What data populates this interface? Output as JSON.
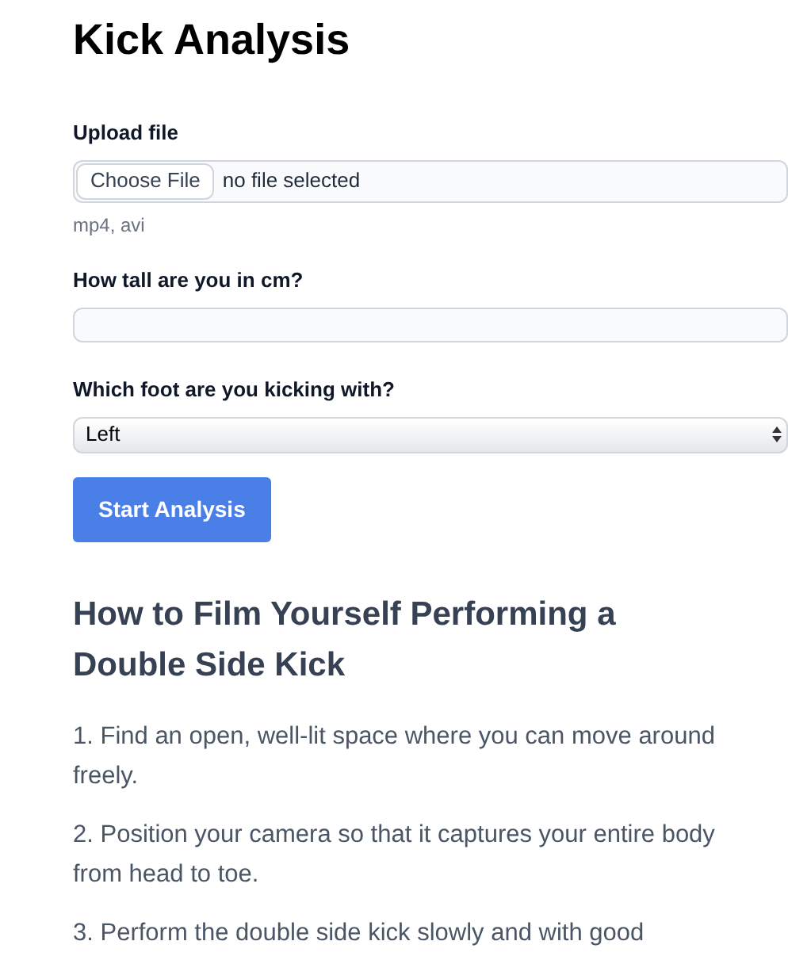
{
  "title": "Kick Analysis",
  "upload": {
    "label": "Upload file",
    "button": "Choose File",
    "status": "no file selected",
    "hint": "mp4, avi"
  },
  "height": {
    "label": "How tall are you in cm?"
  },
  "foot": {
    "label": "Which foot are you kicking with?",
    "value": "Left"
  },
  "submit": "Start Analysis",
  "guide": {
    "heading": "How to Film Yourself Performing a Double Side Kick",
    "steps": [
      "1. Find an open, well-lit space where you can move around freely.",
      "2. Position your camera so that it captures your entire body from head to toe.",
      "3. Perform the double side kick slowly and with good"
    ]
  }
}
